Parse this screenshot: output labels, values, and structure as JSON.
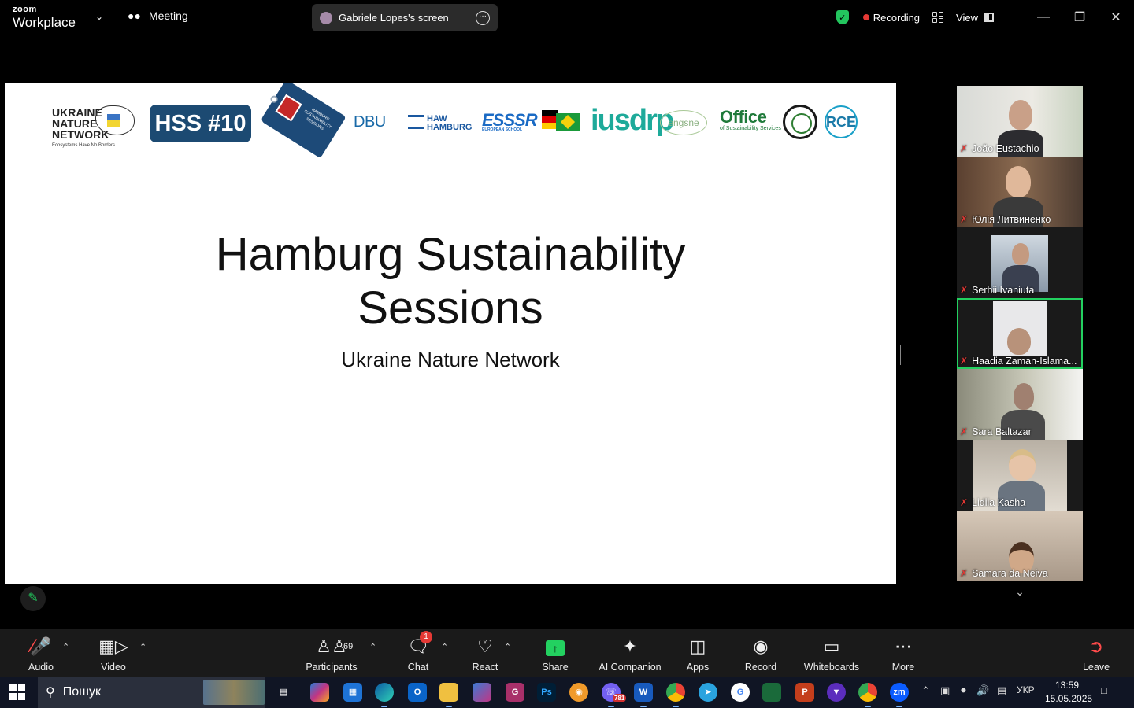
{
  "titlebar": {
    "brand_small": "zoom",
    "brand_big": "Workplace",
    "meeting_tab": "Meeting",
    "screen_pill": "Gabriele Lopes's screen",
    "recording": "Recording",
    "view": "View"
  },
  "slide": {
    "hss_logo": "HSS #10",
    "unn_logo_lines": [
      "UKRAINE",
      "NATURE",
      "NETWORK"
    ],
    "unn_tagline": "Ecosystems Have No Borders",
    "tag_text": "HAMBURG SUSTAINABILITY SESSIONS",
    "dbu": "DBU",
    "haw": "HAW HAMBURG",
    "esssr": "ESSSR",
    "esssr_sub": "EUROPEAN SCHOOL",
    "usdrp": "iusdrp",
    "engsne": "engsne",
    "office": "Office",
    "office_sub": "of Sustainability Services",
    "rce": "RCE",
    "title_line1": "Hamburg Sustainability",
    "title_line2": "Sessions",
    "subtitle": "Ukraine Nature Network"
  },
  "participants": [
    {
      "name": "João Eustachio",
      "muted": true
    },
    {
      "name": "Юлія Литвиненко",
      "muted": true
    },
    {
      "name": "Serhii Ivaniuta",
      "muted": true
    },
    {
      "name": "Haadia Zaman-Islama...",
      "muted": true,
      "active": true
    },
    {
      "name": "Sara Baltazar",
      "muted": true
    },
    {
      "name": "Lidiia Kasha",
      "muted": true
    },
    {
      "name": "Samara da Neiva",
      "muted": true
    }
  ],
  "toolbar": {
    "audio": "Audio",
    "video": "Video",
    "participants": "Participants",
    "participants_count": "69",
    "chat": "Chat",
    "chat_badge": "1",
    "react": "React",
    "share": "Share",
    "ai": "AI Companion",
    "apps": "Apps",
    "record": "Record",
    "whiteboards": "Whiteboards",
    "more": "More",
    "leave": "Leave"
  },
  "taskbar": {
    "search_placeholder": "Пошук",
    "viber_badge": "781",
    "lang": "УКР",
    "time": "13:59",
    "date": "15.05.2025"
  },
  "colors": {
    "active_border": "#23d160",
    "recording_dot": "#e53935",
    "hss_blue": "#1c4a72"
  }
}
